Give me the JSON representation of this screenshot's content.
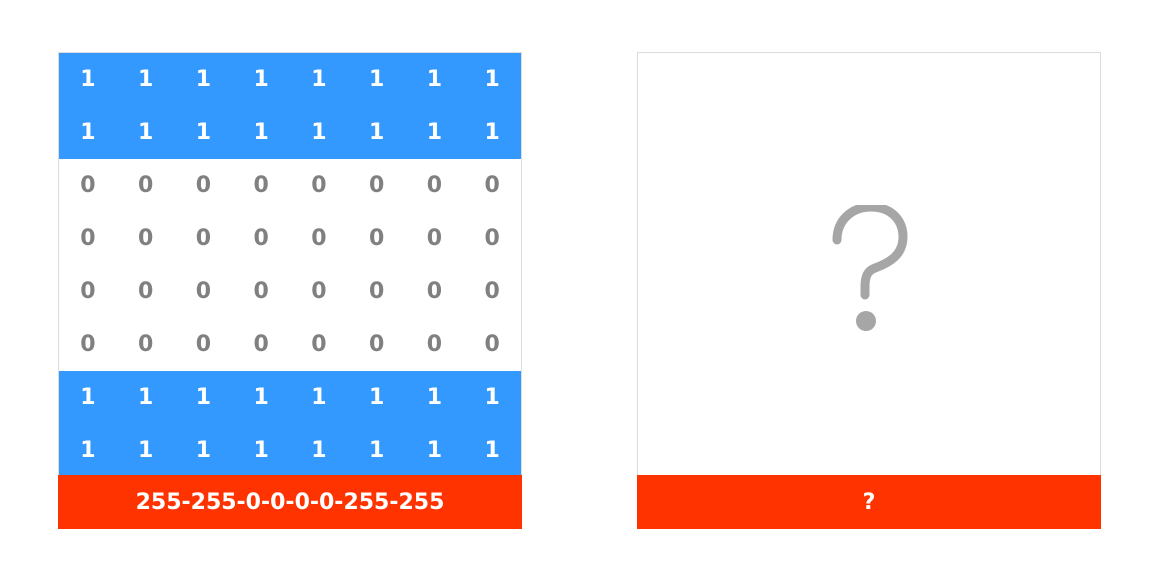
{
  "rows": [
    {
      "state": "on",
      "cells": [
        "1",
        "1",
        "1",
        "1",
        "1",
        "1",
        "1",
        "1"
      ]
    },
    {
      "state": "on",
      "cells": [
        "1",
        "1",
        "1",
        "1",
        "1",
        "1",
        "1",
        "1"
      ]
    },
    {
      "state": "off",
      "cells": [
        "0",
        "0",
        "0",
        "0",
        "0",
        "0",
        "0",
        "0"
      ]
    },
    {
      "state": "off",
      "cells": [
        "0",
        "0",
        "0",
        "0",
        "0",
        "0",
        "0",
        "0"
      ]
    },
    {
      "state": "off",
      "cells": [
        "0",
        "0",
        "0",
        "0",
        "0",
        "0",
        "0",
        "0"
      ]
    },
    {
      "state": "off",
      "cells": [
        "0",
        "0",
        "0",
        "0",
        "0",
        "0",
        "0",
        "0"
      ]
    },
    {
      "state": "on",
      "cells": [
        "1",
        "1",
        "1",
        "1",
        "1",
        "1",
        "1",
        "1"
      ]
    },
    {
      "state": "on",
      "cells": [
        "1",
        "1",
        "1",
        "1",
        "1",
        "1",
        "1",
        "1"
      ]
    }
  ],
  "left_footer": "255-255-0-0-0-0-255-255",
  "right_footer": "?",
  "right_icon": "question-mark-icon",
  "colors": {
    "on": "#3399ff",
    "off": "#ffffff",
    "footer": "#ff3300",
    "icon": "#a6a6a6"
  }
}
